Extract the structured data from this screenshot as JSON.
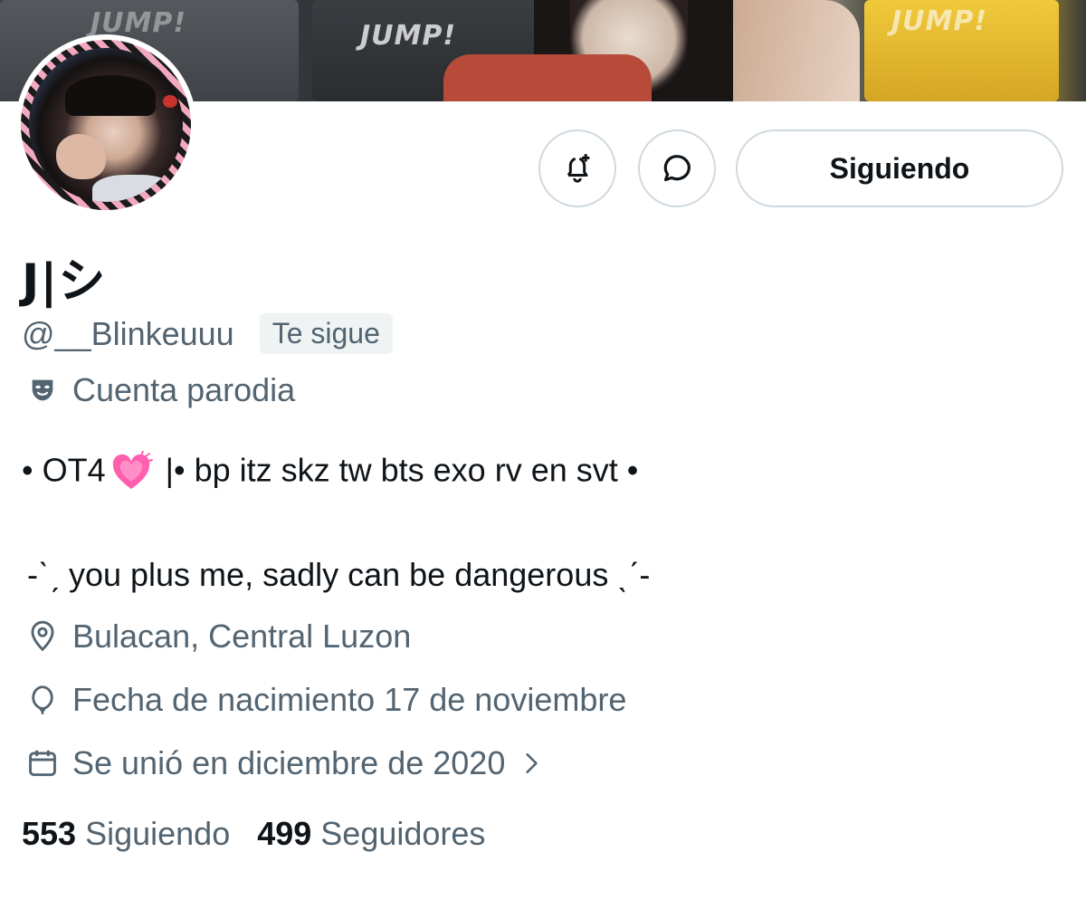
{
  "banner": {
    "jersey_text": "JUMP!"
  },
  "actions": {
    "notify_icon": "bell-plus-icon",
    "message_icon": "message-bubble-icon",
    "follow_label": "Siguiendo"
  },
  "profile": {
    "display_name": "J|シ",
    "handle": "@__Blinkeuuu",
    "follows_you": "Te sigue",
    "parody_label": "Cuenta parodia",
    "bio_line1_before": "• OT4",
    "bio_line1_emoji": "growing-heart-icon",
    "bio_line1_after": " |• bp itz skz tw bts exo rv en svt •",
    "bio_line2": "-ˋˏ you plus me, sadly can be dangerous ˎˊ-",
    "location": "Bulacan, Central Luzon",
    "birthday": "Fecha de nacimiento 17 de noviembre",
    "joined": "Se unió en diciembre de 2020"
  },
  "stats": {
    "following_count": "553",
    "following_label": "Siguiendo",
    "followers_count": "499",
    "followers_label": "Seguidores"
  },
  "colors": {
    "text_primary": "#0f1419",
    "text_secondary": "#536471",
    "border": "#cfd9de",
    "badge_bg": "#eff3f4",
    "heart": "#ff4fa3"
  }
}
